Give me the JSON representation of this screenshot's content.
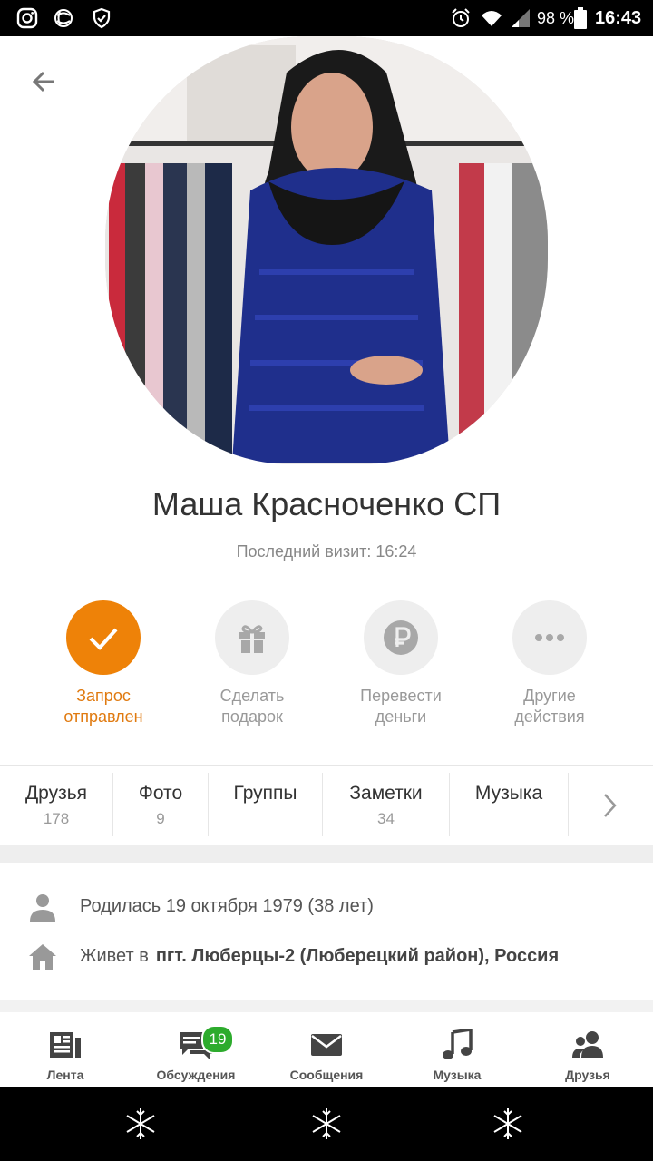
{
  "status": {
    "battery": "98 %",
    "time": "16:43"
  },
  "profile": {
    "name": "Маша Красноченко СП",
    "last_visit": "Последний визит: 16:24"
  },
  "actions": [
    {
      "label1": "Запрос",
      "label2": "отправлен"
    },
    {
      "label1": "Сделать",
      "label2": "подарок"
    },
    {
      "label1": "Перевести",
      "label2": "деньги"
    },
    {
      "label1": "Другие",
      "label2": "действия"
    }
  ],
  "tabs": [
    {
      "title": "Друзья",
      "count": "178"
    },
    {
      "title": "Фото",
      "count": "9"
    },
    {
      "title": "Группы",
      "count": ""
    },
    {
      "title": "Заметки",
      "count": "34"
    },
    {
      "title": "Музыка",
      "count": ""
    }
  ],
  "info": {
    "born": "Родилась 19 октября 1979 (38 лет)",
    "lives_prefix": "Живет в",
    "lives_place": "пгт. Люберцы-2 (Люберецкий район), Россия"
  },
  "nav": [
    {
      "label": "Лента"
    },
    {
      "label": "Обсуждения",
      "badge": "19"
    },
    {
      "label": "Сообщения"
    },
    {
      "label": "Музыка"
    },
    {
      "label": "Друзья"
    }
  ],
  "colors": {
    "accent": "#ee8208",
    "badge": "#2dab2d"
  }
}
